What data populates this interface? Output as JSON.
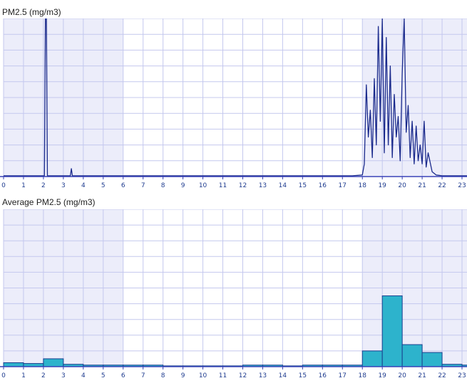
{
  "charts": [
    {
      "title": "PM2.5 (mg/m3)"
    },
    {
      "title": "Average PM2.5 (mg/m3)"
    }
  ],
  "colors": {
    "grid": "#c4c8ee",
    "axis": "#3a43b8",
    "shade": "#ecedfa",
    "line": "#1a2a8c",
    "bar": "#2db3cc",
    "bar_stroke": "#1a3f8f",
    "tick_text": "#1f3c8f"
  },
  "chart_data": [
    {
      "type": "line",
      "title": "PM2.5 (mg/m3)",
      "xlabel": "",
      "ylabel": "",
      "xlim": [
        0,
        23.25
      ],
      "ylim": [
        0,
        10
      ],
      "grid": true,
      "x_ticks": [
        "0",
        "1",
        "2",
        "3",
        "4",
        "5",
        "6",
        "7",
        "8",
        "9",
        "10",
        "11",
        "12",
        "13",
        "14",
        "15",
        "16",
        "17",
        "18",
        "19",
        "20",
        "21",
        "22",
        "23"
      ],
      "shaded_ranges": [
        [
          0,
          6
        ],
        [
          18,
          23.25
        ]
      ],
      "x": [
        0,
        2.05,
        2.1,
        2.15,
        2.2,
        3.35,
        3.4,
        3.45,
        4,
        8,
        12,
        16,
        17.5,
        18.0,
        18.1,
        18.2,
        18.3,
        18.4,
        18.5,
        18.6,
        18.7,
        18.8,
        18.9,
        19.0,
        19.1,
        19.2,
        19.3,
        19.4,
        19.5,
        19.6,
        19.7,
        19.8,
        19.9,
        20.0,
        20.1,
        20.2,
        20.3,
        20.4,
        20.5,
        20.6,
        20.7,
        20.8,
        20.9,
        21.0,
        21.1,
        21.2,
        21.3,
        21.5,
        21.7,
        22,
        23,
        23.25
      ],
      "y": [
        0.05,
        0.05,
        10,
        10,
        0.05,
        0.05,
        0.5,
        0.05,
        0.05,
        0.05,
        0.05,
        0.05,
        0.05,
        0.1,
        0.8,
        5.8,
        2.5,
        4.2,
        1.2,
        6.2,
        2.0,
        9.5,
        3.5,
        10,
        1.5,
        8.8,
        2.0,
        7.0,
        1.2,
        5.2,
        2.5,
        3.8,
        1.0,
        6.5,
        10,
        2.8,
        4.5,
        1.2,
        3.5,
        0.8,
        3.2,
        1.0,
        2.0,
        0.8,
        3.5,
        0.6,
        1.5,
        0.3,
        0.1,
        0.05,
        0.05,
        0.05
      ]
    },
    {
      "type": "bar",
      "title": "Average PM2.5 (mg/m3)",
      "xlabel": "",
      "ylabel": "",
      "xlim": [
        0,
        23.25
      ],
      "ylim": [
        0,
        10
      ],
      "grid": true,
      "x_ticks": [
        "0",
        "1",
        "2",
        "3",
        "4",
        "5",
        "6",
        "7",
        "8",
        "9",
        "10",
        "11",
        "12",
        "13",
        "14",
        "15",
        "16",
        "17",
        "18",
        "19",
        "20",
        "21",
        "22",
        "23"
      ],
      "shaded_ranges": [
        [
          0,
          6
        ],
        [
          18,
          23.25
        ]
      ],
      "categories": [
        "0",
        "1",
        "2",
        "3",
        "4",
        "5",
        "6",
        "7",
        "8",
        "9",
        "10",
        "11",
        "12",
        "13",
        "14",
        "15",
        "16",
        "17",
        "18",
        "19",
        "20",
        "21",
        "22",
        "23"
      ],
      "values": [
        0.25,
        0.2,
        0.5,
        0.15,
        0.1,
        0.1,
        0.1,
        0.1,
        0.05,
        0.05,
        0.05,
        0.05,
        0.1,
        0.1,
        0.05,
        0.1,
        0.1,
        0.1,
        1.0,
        4.5,
        1.4,
        0.9,
        0.15,
        0.1
      ]
    }
  ]
}
